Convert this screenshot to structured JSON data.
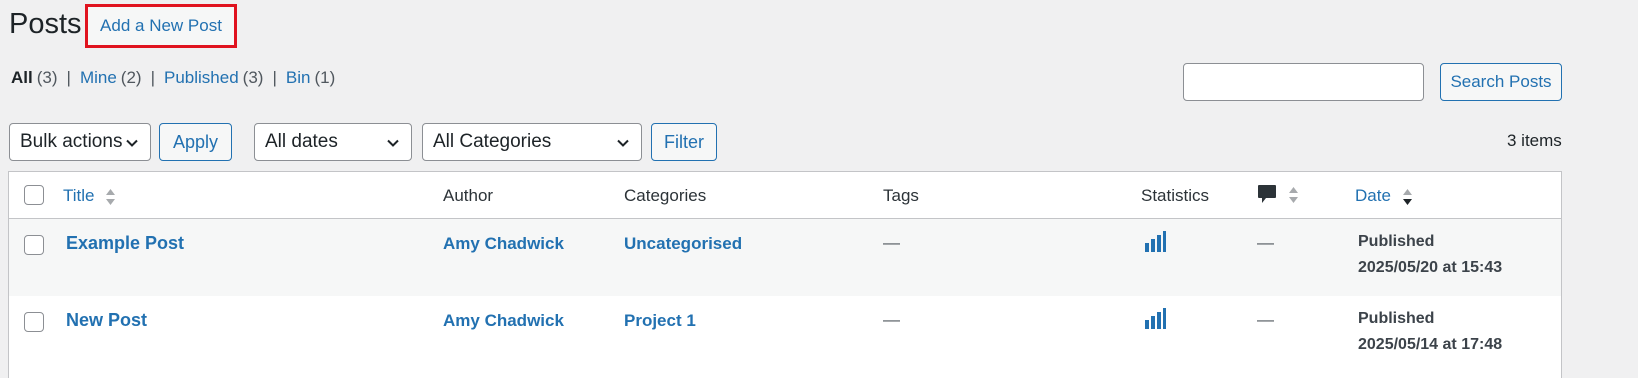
{
  "header": {
    "title": "Posts",
    "add_new_label": "Add a New Post"
  },
  "views": [
    {
      "label": "All",
      "count": "(3)"
    },
    {
      "label": "Mine",
      "count": "(2)"
    },
    {
      "label": "Published",
      "count": "(3)"
    },
    {
      "label": "Bin",
      "count": "(1)"
    }
  ],
  "views_separator": "|",
  "search": {
    "value": "",
    "button_label": "Search Posts"
  },
  "tablenav": {
    "bulk_actions": "Bulk actions",
    "apply_label": "Apply",
    "dates_filter": "All dates",
    "categories_filter": "All Categories",
    "filter_label": "Filter",
    "items_count": "3 items"
  },
  "columns": {
    "title": "Title",
    "author": "Author",
    "categories": "Categories",
    "tags": "Tags",
    "statistics": "Statistics",
    "comments_icon": "comment-icon",
    "date": "Date"
  },
  "rows": [
    {
      "title": "Example Post",
      "author": "Amy Chadwick",
      "category": "Uncategorised",
      "tags": "—",
      "comments": "—",
      "status": "Published",
      "date": "2025/05/20 at 15:43"
    },
    {
      "title": "New Post",
      "author": "Amy Chadwick",
      "category": "Project 1",
      "tags": "—",
      "comments": "—",
      "status": "Published",
      "date": "2025/05/14 at 17:48"
    }
  ],
  "colors": {
    "link": "#2271b1",
    "highlight_border": "#e0131f",
    "background": "#f0f0f1",
    "text": "#1d2327"
  }
}
